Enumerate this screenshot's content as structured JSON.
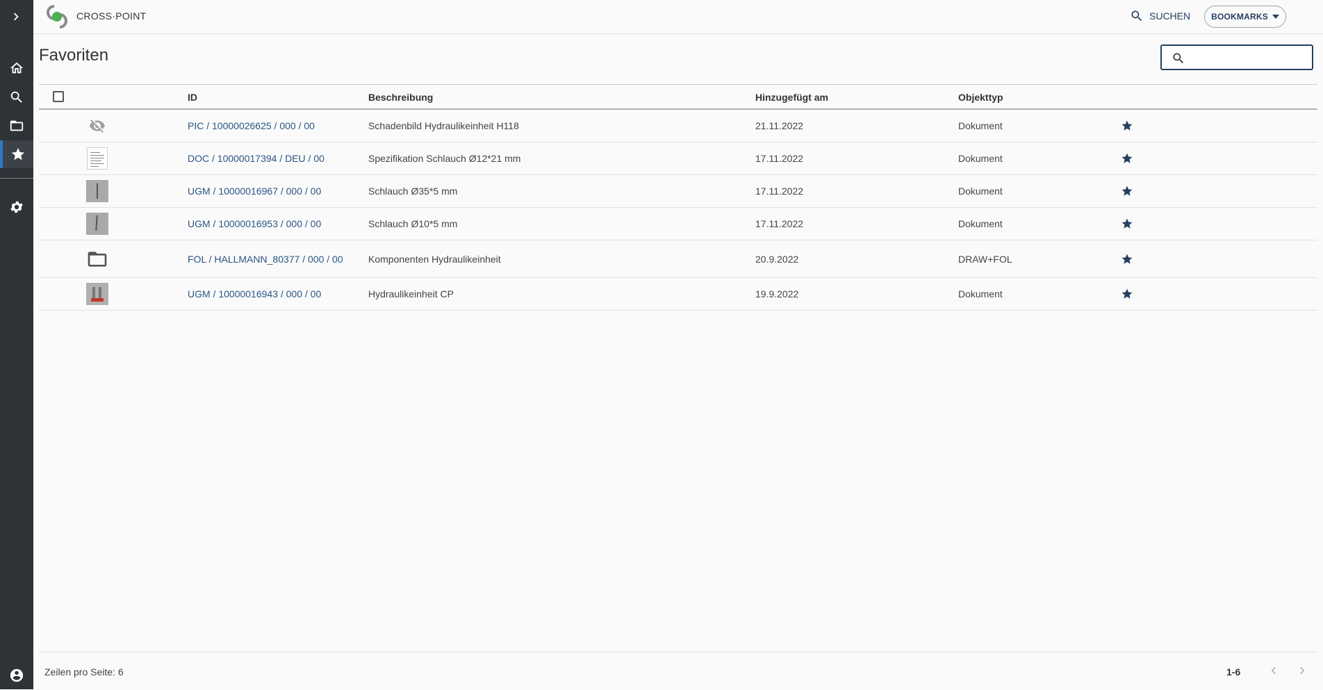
{
  "app": {
    "brand": "CROSS·POINT"
  },
  "header": {
    "search_label": "SUCHEN",
    "bookmarks_label": "BOOKMARKS"
  },
  "page": {
    "title": "Favoriten",
    "filter_placeholder": ""
  },
  "table": {
    "columns": [
      "ID",
      "Beschreibung",
      "Hinzugefügt am",
      "Objekttyp"
    ],
    "rows": [
      {
        "id": "PIC / 10000026625 / 000 / 00",
        "description": "Schadenbild Hydraulikeinheit H118",
        "added": "21.11.2022",
        "type": "Dokument",
        "thumb": "hidden-eye-icon"
      },
      {
        "id": "DOC / 10000017394 / DEU / 00",
        "description": "Spezifikation Schlauch Ø12*21 mm",
        "added": "17.11.2022",
        "type": "Dokument",
        "thumb": "document-thumbnail"
      },
      {
        "id": "UGM / 10000016967 / 000 / 00",
        "description": "Schlauch Ø35*5 mm",
        "added": "17.11.2022",
        "type": "Dokument",
        "thumb": "hose-thumbnail"
      },
      {
        "id": "UGM / 10000016953 / 000 / 00",
        "description": "Schlauch Ø10*5 mm",
        "added": "17.11.2022",
        "type": "Dokument",
        "thumb": "hose-thumbnail"
      },
      {
        "id": "FOL / HALLMANN_80377 / 000 / 00",
        "description": "Komponenten Hydraulikeinheit",
        "added": "20.9.2022",
        "type": "DRAW+FOL",
        "thumb": "folder-icon"
      },
      {
        "id": "UGM / 10000016943 / 000 / 00",
        "description": "Hydraulikeinheit CP",
        "added": "19.9.2022",
        "type": "Dokument",
        "thumb": "hydraulic-unit-thumbnail"
      }
    ]
  },
  "footer": {
    "rows_per_page": "Zeilen pro Seite: 6",
    "range": "1-6"
  },
  "colors": {
    "accent": "#253f5f",
    "sidebar": "#2e3338",
    "active_indicator": "#2f78c4"
  }
}
